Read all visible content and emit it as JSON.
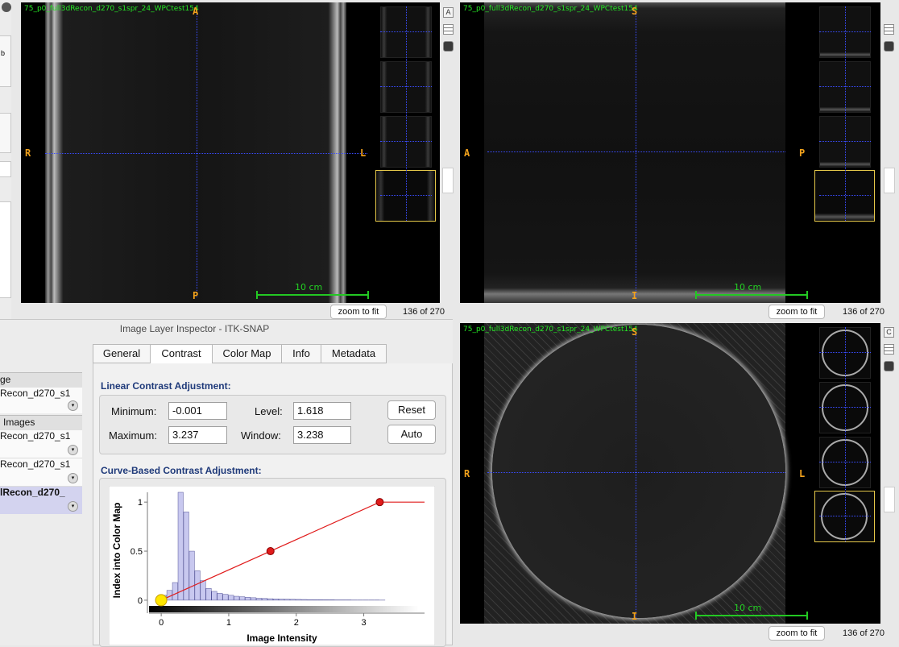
{
  "views": {
    "axial": {
      "title": "75_p0_full3dRecon_d270_s1spr_24_WPCtest154",
      "top": "A",
      "bottom": "P",
      "left": "R",
      "right": "L",
      "scale": "10 cm",
      "zoom": "zoom to fit",
      "slice": "136 of 270"
    },
    "sagittal": {
      "title": "75_p0_full3dRecon_d270_s1spr_24_WPCtest154",
      "top": "S",
      "bottom": "I",
      "left": "A",
      "right": "P",
      "scale": "10 cm",
      "zoom": "zoom to fit",
      "slice": "136 of 270"
    },
    "coronal": {
      "title": "75_p0_full3dRecon_d270_s1spr_24_WPCtest154",
      "top": "S",
      "bottom": "I",
      "left": "R",
      "right": "L",
      "scale": "10 cm",
      "zoom": "zoom to fit",
      "slice": "136 of 270"
    }
  },
  "side_icons": {
    "a": "A",
    "c": "C"
  },
  "left_strip": {
    "b_label": "b"
  },
  "inspector": {
    "title": "Image Layer Inspector - ITK-SNAP",
    "layers": {
      "header_main": "ge",
      "main_item": "Recon_d270_s1",
      "header_additional": "Images",
      "item2": "Recon_d270_s1",
      "item3": "Recon_d270_s1",
      "item4": "lRecon_d270_"
    },
    "tabs": [
      "General",
      "Contrast",
      "Color Map",
      "Info",
      "Metadata"
    ],
    "active_tab": "Contrast",
    "linear": {
      "title": "Linear Contrast Adjustment:",
      "minimum_label": "Minimum:",
      "minimum": "-0.001",
      "maximum_label": "Maximum:",
      "maximum": "3.237",
      "level_label": "Level:",
      "level": "1.618",
      "window_label": "Window:",
      "window": "3.238",
      "reset": "Reset",
      "auto": "Auto"
    },
    "curve_title": "Curve-Based Contrast Adjustment:"
  },
  "chart_data": {
    "type": "line",
    "xlabel": "Image Intensity",
    "ylabel": "Index into Color Map",
    "xlim": [
      -0.3,
      3.9
    ],
    "ylim": [
      -0.05,
      1.1
    ],
    "xticks": [
      "0",
      "1",
      "2",
      "3"
    ],
    "yticks": [
      "0",
      "0.5",
      "1"
    ],
    "curve": {
      "x": [
        -0.001,
        1.618,
        3.237,
        3.9
      ],
      "y": [
        0,
        0.5,
        1,
        1
      ]
    },
    "control_points": {
      "x": [
        -0.001,
        1.618,
        3.237
      ],
      "y": [
        0,
        0.5,
        1
      ]
    },
    "histogram": {
      "bin_start": 0,
      "bin_width": 0.083,
      "values": [
        0.05,
        0.1,
        0.18,
        1.1,
        0.9,
        0.5,
        0.3,
        0.2,
        0.12,
        0.09,
        0.07,
        0.06,
        0.05,
        0.04,
        0.035,
        0.03,
        0.025,
        0.02,
        0.018,
        0.015,
        0.013,
        0.011,
        0.01,
        0.009,
        0.008,
        0.007,
        0.006,
        0.005,
        0.005,
        0.004,
        0.004,
        0.003,
        0.003,
        0.003,
        0.002,
        0.002,
        0.002,
        0.002,
        0.002,
        0.001
      ]
    }
  }
}
